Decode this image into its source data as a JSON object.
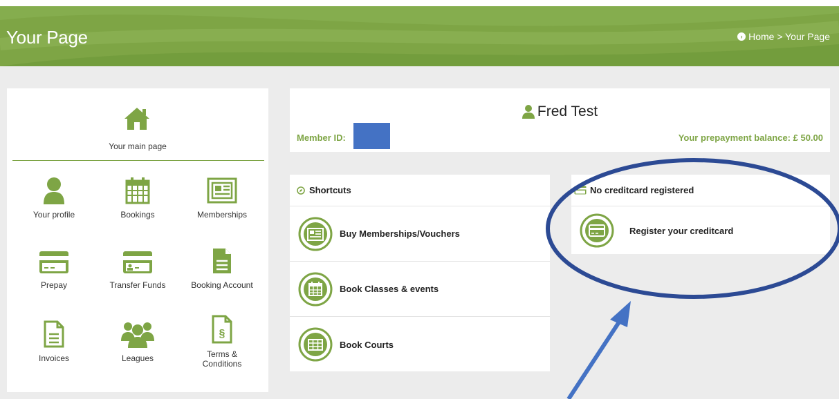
{
  "header": {
    "title": "Your Page",
    "breadcrumb": "Home > Your Page"
  },
  "sidebar": {
    "main_page_label": "Your main page",
    "items": [
      {
        "label": "Your profile",
        "icon": "user-icon"
      },
      {
        "label": "Bookings",
        "icon": "calendar-icon"
      },
      {
        "label": "Memberships",
        "icon": "newspaper-icon"
      },
      {
        "label": "Prepay",
        "icon": "credit-card-icon"
      },
      {
        "label": "Transfer Funds",
        "icon": "id-card-icon"
      },
      {
        "label": "Booking Account",
        "icon": "document-icon"
      },
      {
        "label": "Invoices",
        "icon": "invoice-icon"
      },
      {
        "label": "Leagues",
        "icon": "users-icon"
      },
      {
        "label": "Terms & Conditions",
        "icon": "terms-icon"
      }
    ]
  },
  "profile": {
    "name": "Fred Test",
    "member_id_label": "Member ID:",
    "balance": "Your prepayment balance: £ 50.00"
  },
  "shortcuts": {
    "title": "Shortcuts",
    "items": [
      {
        "label": "Buy Memberships/Vouchers",
        "icon": "newspaper-icon"
      },
      {
        "label": "Book Classes & events",
        "icon": "calendar-icon"
      },
      {
        "label": "Book Courts",
        "icon": "grid-icon"
      }
    ]
  },
  "creditcard": {
    "title": "No creditcard registered",
    "action": "Register your creditcard"
  },
  "colors": {
    "accent": "#7ea545",
    "annotation": "#2c4a94",
    "redaction": "#4472c4"
  }
}
